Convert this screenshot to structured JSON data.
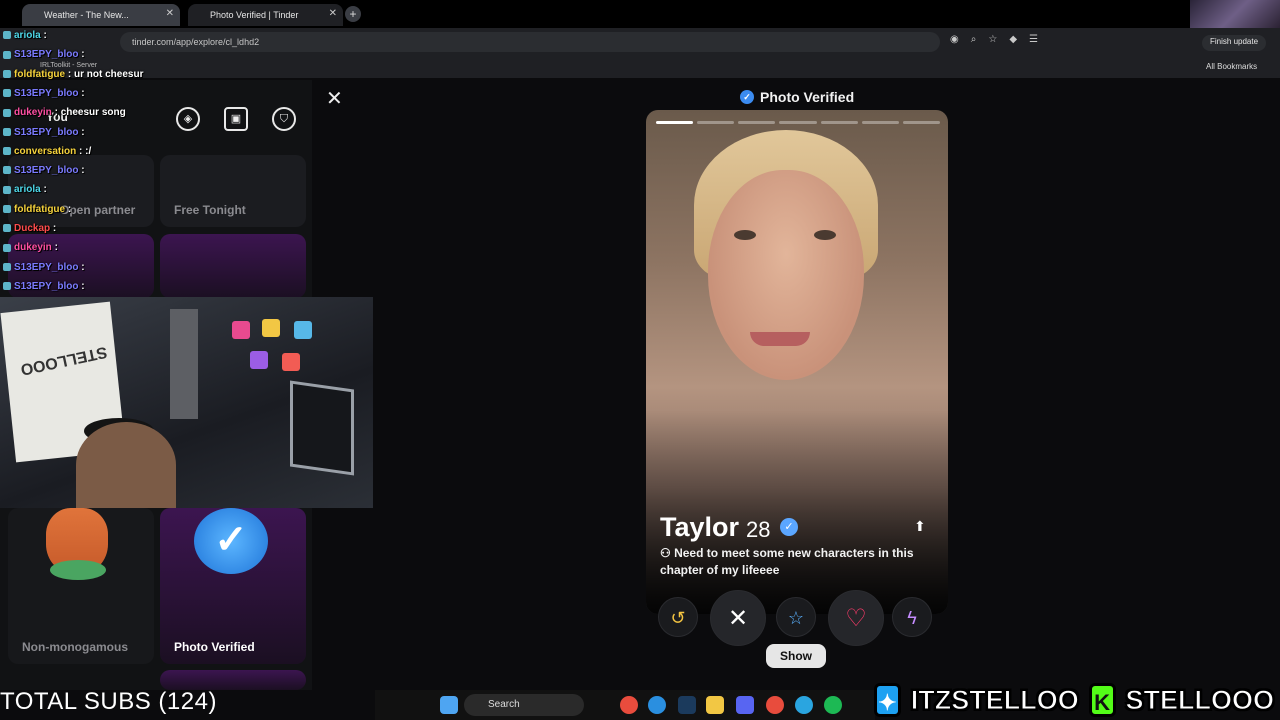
{
  "browser": {
    "tabs": [
      {
        "label": "Weather - The New..."
      },
      {
        "label": "Photo Verified | Tinder"
      }
    ],
    "new_tab": "+",
    "url": "tinder.com/app/explore/cl_ldhd2",
    "finish_update": "Finish update",
    "bookmark_item": "IRLToolkit - Server",
    "all_bookmarks": "All Bookmarks"
  },
  "tinder": {
    "nav_you": "You",
    "cards": {
      "open_partner": "Open partner",
      "free_tonight": "Free Tonight",
      "non_monogamous": "Non-monogamous",
      "photo_verified": "Photo Verified"
    },
    "header_title": "Photo Verified",
    "profile": {
      "name": "Taylor",
      "age": "28",
      "bio": "Need to meet some new characters in this chapter of my lifeeee",
      "photo_count": 7,
      "active_photo": 1
    },
    "show_button": "Show"
  },
  "chat": [
    {
      "user": "ariola",
      "color": "#4ed7e8",
      "msg": ""
    },
    {
      "user": "S13EPY_bloo",
      "color": "#7b7bff",
      "msg": ""
    },
    {
      "user": "foldfatigue",
      "color": "#f5d23c",
      "msg": "ur not cheesur"
    },
    {
      "user": "S13EPY_bloo",
      "color": "#7b7bff",
      "msg": ""
    },
    {
      "user": "dukeyin",
      "color": "#ff4fa3",
      "msg": "cheesur song"
    },
    {
      "user": "S13EPY_bloo",
      "color": "#7b7bff",
      "msg": ""
    },
    {
      "user": "conversation",
      "color": "#f5d23c",
      "msg": ":/"
    },
    {
      "user": "S13EPY_bloo",
      "color": "#7b7bff",
      "msg": ""
    },
    {
      "user": "ariola",
      "color": "#4ed7e8",
      "msg": ""
    },
    {
      "user": "foldfatigue",
      "color": "#f5d23c",
      "msg": ""
    },
    {
      "user": "Duckap",
      "color": "#ff4c4c",
      "msg": ""
    },
    {
      "user": "dukeyin",
      "color": "#ff4fa3",
      "msg": ""
    },
    {
      "user": "S13EPY_bloo",
      "color": "#7b7bff",
      "msg": ""
    },
    {
      "user": "S13EPY_bloo",
      "color": "#7b7bff",
      "msg": ""
    },
    {
      "user": "dukeyin",
      "color": "#ff4fa3",
      "msg": ""
    }
  ],
  "webcam": {
    "sign_text": "STELLOOO"
  },
  "overlay": {
    "total_subs": "TOTAL SUBS (124)",
    "twitter_handle": "ITZSTELLOO",
    "kick_handle": "STELLOOO",
    "kick_logo": "K"
  },
  "taskbar": {
    "search": "Search"
  },
  "colors": {
    "tinder_like": "#ff3b6b",
    "super_like": "#5ab1ff",
    "boost": "#c58cff",
    "verified_blue": "#3b8bf0"
  }
}
